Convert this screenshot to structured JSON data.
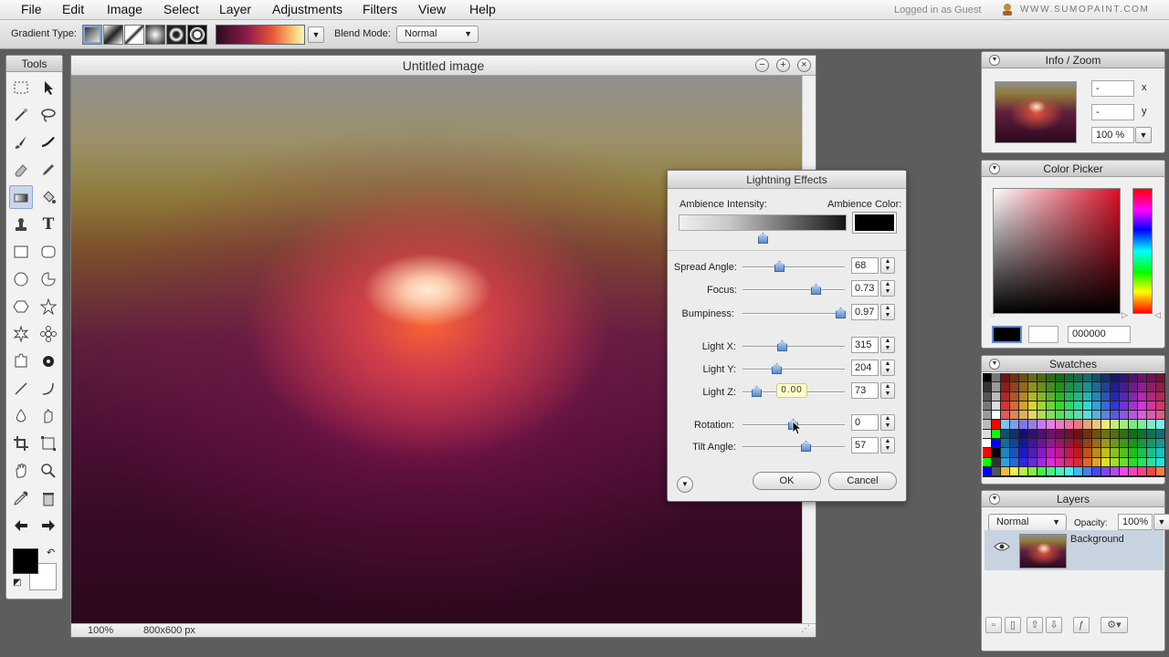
{
  "menu": {
    "items": [
      "File",
      "Edit",
      "Image",
      "Select",
      "Layer",
      "Adjustments",
      "Filters",
      "View",
      "Help"
    ],
    "status": "Logged in as Guest",
    "site": "WWW.SUMOPAINT.COM"
  },
  "options": {
    "gradient_type_label": "Gradient Type:",
    "blend_mode_label": "Blend Mode:",
    "blend_mode_value": "Normal"
  },
  "tools": {
    "title": "Tools"
  },
  "document": {
    "title": "Untitled image",
    "zoom": "100%",
    "size": "800x600 px"
  },
  "dialog": {
    "title": "Lightning Effects",
    "ambience_intensity_label": "Ambience Intensity:",
    "ambience_color_label": "Ambience Color:",
    "ambience_color": "#000000",
    "ambience_intensity": 0.5,
    "tooltip": "0.00",
    "ok_label": "OK",
    "cancel_label": "Cancel",
    "sliders": [
      {
        "label": "Spread Angle:",
        "value": "68"
      },
      {
        "label": "Focus:",
        "value": "0.73"
      },
      {
        "label": "Bumpiness:",
        "value": "0.97"
      },
      {
        "label": "Light X:",
        "value": "315"
      },
      {
        "label": "Light Y:",
        "value": "204"
      },
      {
        "label": "Light Z:",
        "value": "73"
      },
      {
        "label": "Rotation:",
        "value": "0"
      },
      {
        "label": "Tilt Angle:",
        "value": "57"
      }
    ]
  },
  "info_panel": {
    "title": "Info / Zoom",
    "x_value": "-",
    "y_value": "-",
    "x_label": "x",
    "y_label": "y",
    "zoom_value": "100 %"
  },
  "color_picker": {
    "title": "Color Picker",
    "hex_value": "000000",
    "foreground": "#000000",
    "background": "#ffffff"
  },
  "swatches": {
    "title": "Swatches"
  },
  "layers": {
    "title": "Layers",
    "blend_mode": "Normal",
    "opacity_label": "Opacity:",
    "opacity_value": "100%",
    "layer_name": "Background"
  }
}
